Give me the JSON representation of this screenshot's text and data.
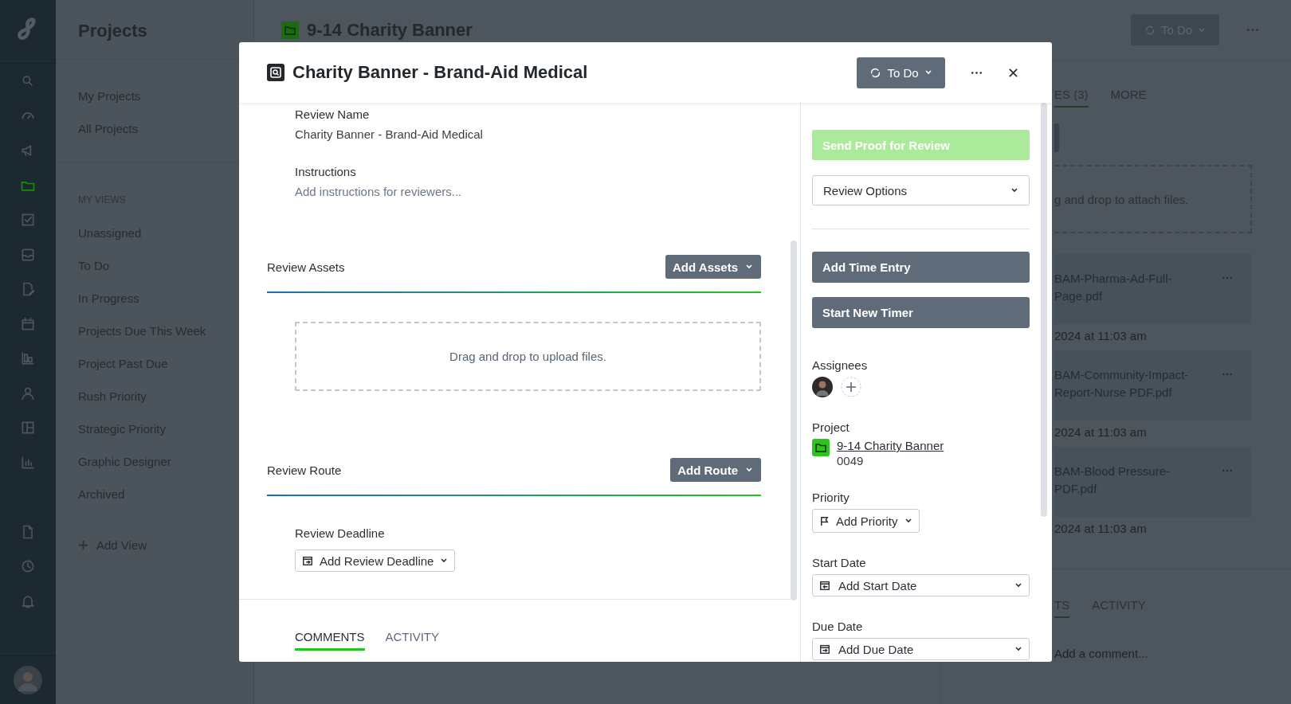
{
  "rail": {
    "items": [
      {
        "kind": "search",
        "selected": false
      },
      {
        "kind": "gauge",
        "selected": false
      },
      {
        "kind": "megaphone",
        "selected": false
      },
      {
        "kind": "folder",
        "selected": true
      },
      {
        "kind": "checkbox",
        "selected": false
      },
      {
        "kind": "inbox",
        "selected": false
      },
      {
        "kind": "edit-doc",
        "selected": false
      },
      {
        "kind": "calendar",
        "selected": false
      },
      {
        "kind": "blocks",
        "selected": false
      },
      {
        "kind": "person",
        "selected": false
      },
      {
        "kind": "layout",
        "selected": false
      },
      {
        "kind": "bar-chart",
        "selected": false
      },
      {
        "kind": "document",
        "selected": false
      },
      {
        "kind": "clock",
        "selected": false
      },
      {
        "kind": "bell",
        "selected": false
      }
    ]
  },
  "sidebar": {
    "title": "Projects",
    "links": [
      {
        "label": "My Projects"
      },
      {
        "label": "All Projects"
      }
    ],
    "section": "MY VIEWS",
    "views": [
      {
        "label": "Unassigned"
      },
      {
        "label": "To Do"
      },
      {
        "label": "In Progress"
      },
      {
        "label": "Projects Due This Week"
      },
      {
        "label": "Project Past Due"
      },
      {
        "label": "Rush Priority"
      },
      {
        "label": "Strategic Priority"
      },
      {
        "label": "Graphic Designer"
      },
      {
        "label": "Archived"
      }
    ],
    "add_view": "Add View"
  },
  "page": {
    "title": "9-14 Charity Banner",
    "status": "To Do"
  },
  "files_panel": {
    "tabs": [
      {
        "label": "ES (3)",
        "selected": true
      },
      {
        "label": "MORE",
        "selected": false
      }
    ],
    "dropzone": "g and drop to attach files.",
    "files": [
      {
        "name": "BAM-Pharma-Ad-Full-Page.pdf",
        "date": "2024 at 11:03 am"
      },
      {
        "name": "BAM-Community-Impact-Report-Nurse PDF.pdf",
        "date": "2024 at 11:03 am"
      },
      {
        "name": "BAM-Blood Pressure-PDF.pdf",
        "date": "2024 at 11:03 am"
      }
    ],
    "bottom_tabs": [
      {
        "label": "TS",
        "selected": true
      },
      {
        "label": "ACTIVITY",
        "selected": false
      }
    ],
    "comment_placeholder": "Add a comment..."
  },
  "modal": {
    "title": "Charity Banner - Brand-Aid Medical",
    "status": "To Do",
    "review_name": {
      "label": "Review Name",
      "value": "Charity Banner - Brand-Aid Medical"
    },
    "instructions": {
      "label": "Instructions",
      "placeholder": "Add instructions for reviewers..."
    },
    "sections": [
      {
        "title": "Review Assets",
        "button": "Add Assets",
        "dropzone": "Drag and drop to upload files."
      },
      {
        "title": "Review Route",
        "button": "Add Route",
        "deadline_label": "Review Deadline",
        "deadline_button": "Add Review Deadline"
      }
    ],
    "tabs": [
      {
        "label": "COMMENTS",
        "selected": true
      },
      {
        "label": "ACTIVITY",
        "selected": false
      }
    ],
    "side": {
      "send_button": {
        "label": "Send Proof for Review",
        "disabled": true
      },
      "review_options": "Review Options",
      "time_buttons": [
        {
          "label": "Add Time Entry"
        },
        {
          "label": "Start New Timer"
        }
      ],
      "assignees_label": "Assignees",
      "project": {
        "label": "Project",
        "name": "9-14 Charity Banner",
        "number": "0049"
      },
      "priority": {
        "label": "Priority",
        "button": "Add Priority"
      },
      "dates": [
        {
          "label": "Start Date",
          "button": "Add Start Date",
          "kind": "start"
        },
        {
          "label": "Due Date",
          "button": "Add Due Date",
          "kind": "due"
        }
      ]
    }
  }
}
